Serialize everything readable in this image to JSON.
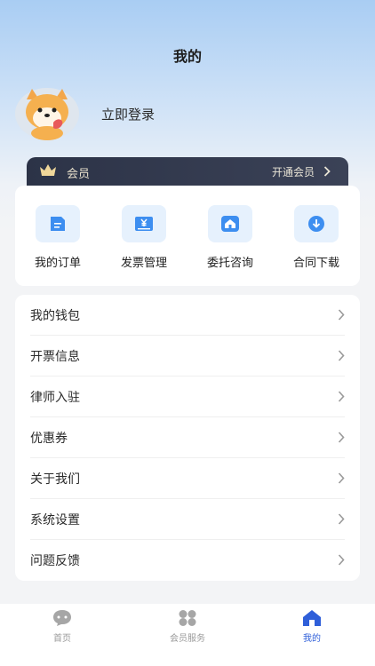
{
  "header": {
    "title": "我的"
  },
  "profile": {
    "login_text": "立即登录",
    "avatar_icon": "shiba-dog-avatar"
  },
  "vip": {
    "label": "会员",
    "action": "开通会员",
    "crown_color": "#f0d79a"
  },
  "quick_actions": [
    {
      "label": "我的订单",
      "icon": "order-document-icon"
    },
    {
      "label": "发票管理",
      "icon": "invoice-yen-icon"
    },
    {
      "label": "委托咨询",
      "icon": "home-consult-icon"
    },
    {
      "label": "合同下载",
      "icon": "download-icon"
    }
  ],
  "menu": [
    {
      "label": "我的钱包"
    },
    {
      "label": "开票信息"
    },
    {
      "label": "律师入驻"
    },
    {
      "label": "优惠券"
    },
    {
      "label": "关于我们"
    },
    {
      "label": "系统设置"
    },
    {
      "label": "问题反馈"
    }
  ],
  "tabbar": [
    {
      "label": "首页",
      "icon": "chat-bubble-icon",
      "active": false
    },
    {
      "label": "会员服务",
      "icon": "grid-services-icon",
      "active": false
    },
    {
      "label": "我的",
      "icon": "house-icon",
      "active": true
    }
  ],
  "colors": {
    "accent": "#2f5fd9",
    "icon_blue": "#3d8ef0",
    "icon_bg": "#e6f1fd",
    "vip_bar": "#2c3347"
  }
}
